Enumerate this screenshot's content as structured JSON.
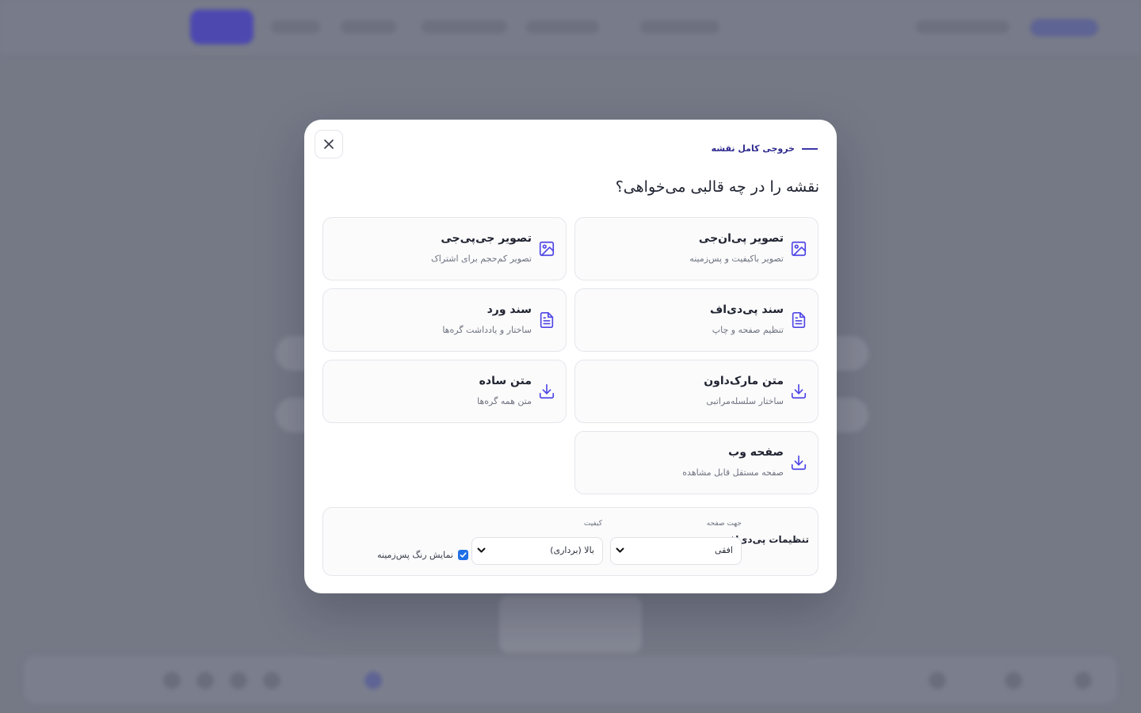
{
  "modal": {
    "eyebrow": "خروجی کامل نقشه",
    "title": "نقشه را در چه قالبی می‌خواهی؟",
    "close_icon": "close-icon"
  },
  "options": [
    {
      "title": "تصویر پی‌ان‌جی",
      "subtitle": "تصویر باکیفیت و پس‌زمینه",
      "icon": "image-icon"
    },
    {
      "title": "تصویر جی‌پی‌جی",
      "subtitle": "تصویر کم‌حجم برای اشتراک",
      "icon": "image-icon"
    },
    {
      "title": "سند پی‌دی‌اف",
      "subtitle": "تنظیم صفحه و چاپ",
      "icon": "document-icon"
    },
    {
      "title": "سند ورد",
      "subtitle": "ساختار و یادداشت گره‌ها",
      "icon": "document-icon"
    },
    {
      "title": "متن مارک‌داون",
      "subtitle": "ساختار سلسله‌مراتبی",
      "icon": "download-icon"
    },
    {
      "title": "متن ساده",
      "subtitle": "متن همه گره‌ها",
      "icon": "download-icon"
    },
    {
      "title": "صفحه وب",
      "subtitle": "صفحه مستقل قابل مشاهده",
      "icon": "download-icon"
    }
  ],
  "pdf_settings": {
    "title": "تنظیمات پی‌دی‌اف",
    "orientation_label": "جهت صفحه",
    "orientation_value": "افقی",
    "quality_label": "کیفیت",
    "quality_value": "بالا (برداری)",
    "background_label": "نمایش رنگ پس‌زمینه",
    "background_checked": true
  },
  "colors": {
    "accent": "#4f46e5",
    "accent_dark": "#2f2b8f",
    "checkbox": "#1f6fe6"
  }
}
